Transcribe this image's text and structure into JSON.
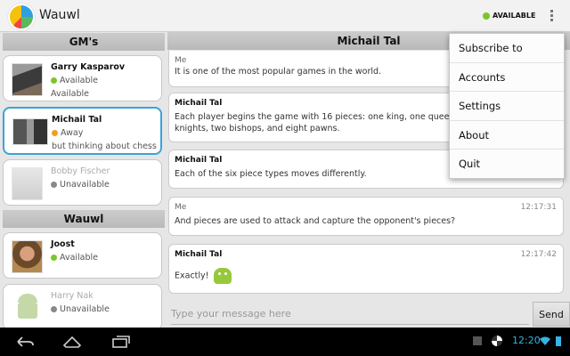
{
  "app": {
    "title": "Wauwl",
    "presence": "AVAILABLE"
  },
  "sidebar": {
    "sections": [
      {
        "title": "GM's",
        "contacts": [
          {
            "name": "Garry Kasparov",
            "status": "Available",
            "message": "Available"
          },
          {
            "name": "Michail Tal",
            "status": "Away",
            "message": "but thinking about chess"
          },
          {
            "name": "Bobby Fischer",
            "status": "Unavailable",
            "message": ""
          }
        ]
      },
      {
        "title": "Wauwl",
        "contacts": [
          {
            "name": "Joost",
            "status": "Available",
            "message": ""
          },
          {
            "name": "Harry Nak",
            "status": "Unavailable",
            "message": ""
          }
        ]
      }
    ]
  },
  "chat": {
    "title": "Michail Tal",
    "messages": [
      {
        "sender": "Me",
        "time": "",
        "text": "It is one of the most popular games in the world."
      },
      {
        "sender": "Michail Tal",
        "time": "",
        "text": "Each player begins the game with 16 pieces: one king, one queen, two rooks, two knights, two bishops, and eight pawns."
      },
      {
        "sender": "Michail Tal",
        "time": "",
        "text": "Each of the six piece types moves differently."
      },
      {
        "sender": "Me",
        "time": "12:17:31",
        "text": "And pieces are used to attack and capture the opponent's pieces?"
      },
      {
        "sender": "Michail Tal",
        "time": "12:17:42",
        "text": "Exactly!"
      }
    ],
    "input_placeholder": "Type your message here",
    "send_label": "Send"
  },
  "menu": {
    "items": [
      "Subscribe to",
      "Accounts",
      "Settings",
      "About",
      "Quit"
    ]
  },
  "system": {
    "clock": "12:20"
  },
  "colors": {
    "accent": "#3aa3d8",
    "available": "#7cc52a",
    "away": "#f0a020",
    "clock": "#33b5e5"
  }
}
